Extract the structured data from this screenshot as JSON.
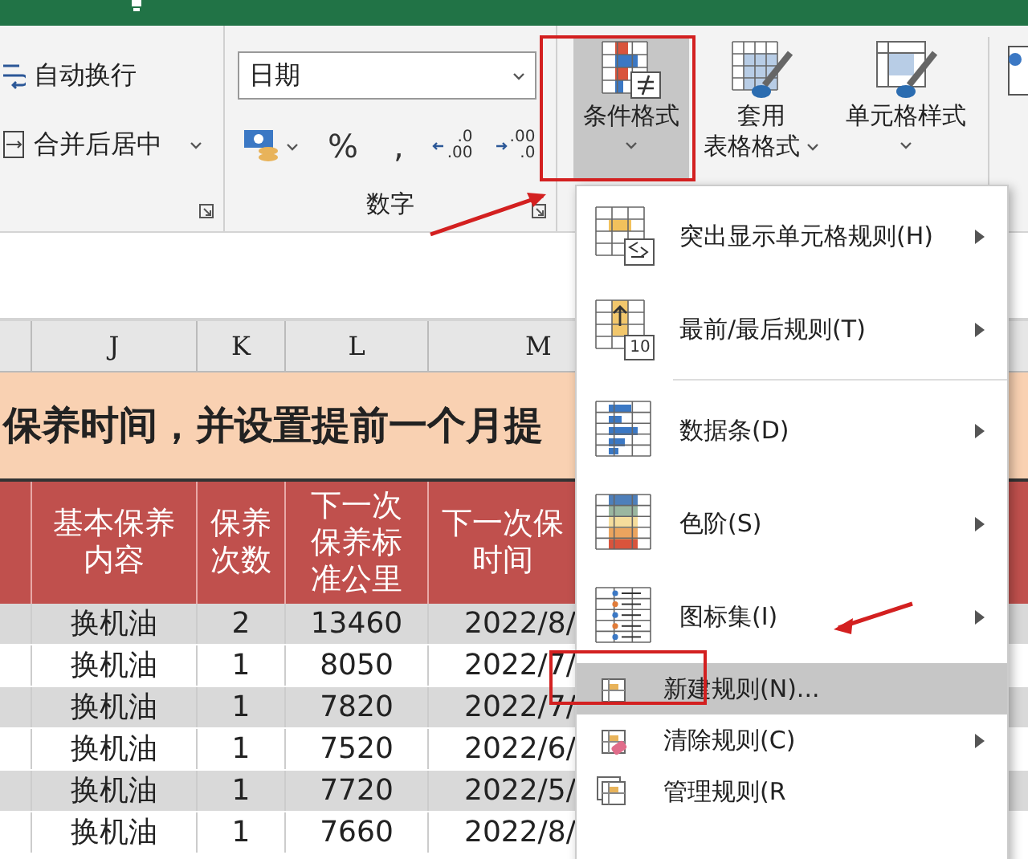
{
  "ribbon": {
    "alignment_group": {
      "items": [
        {
          "kind": "wrap",
          "label": "自动换行",
          "has_dropdown": false
        },
        {
          "kind": "merge",
          "label": "合并后居中",
          "has_dropdown": true
        }
      ]
    },
    "number_group": {
      "format_value": "日期",
      "label": "数字",
      "buttons": [
        {
          "kind": "currency"
        },
        {
          "kind": "text",
          "label": "%"
        },
        {
          "kind": "text",
          "label": ","
        },
        {
          "kind": "increase_decimal",
          "top": ".0",
          "bottom": ".00"
        },
        {
          "kind": "decrease_decimal",
          "top": ".00",
          "bottom": ".0"
        }
      ]
    },
    "style_buttons": [
      {
        "kind": "conditional",
        "lines": [
          "条件格式"
        ],
        "selected": true
      },
      {
        "kind": "table",
        "lines": [
          "套用",
          "表格格式"
        ],
        "selected": false
      },
      {
        "kind": "cell",
        "lines": [
          "单元格样式"
        ],
        "selected": false
      }
    ]
  },
  "sheet": {
    "columns": [
      "J",
      "K",
      "L",
      "M"
    ],
    "title": "保养时间，并设置提前一个月提",
    "headers": [
      "基本保养内容",
      "保养次数",
      "下一次保养标准公里",
      "下一次保时间"
    ],
    "rows": [
      [
        "换机油",
        "2",
        "13460",
        "2022/8/"
      ],
      [
        "换机油",
        "1",
        "8050",
        "2022/7/"
      ],
      [
        "换机油",
        "1",
        "7820",
        "2022/7/"
      ],
      [
        "换机油",
        "1",
        "7520",
        "2022/6/"
      ],
      [
        "换机油",
        "1",
        "7720",
        "2022/5/"
      ],
      [
        "换机油",
        "1",
        "7660",
        "2022/8/"
      ]
    ]
  },
  "menu": {
    "items": [
      {
        "kind": "highlight",
        "label": "突出显示单元格规则(H)",
        "has_submenu": true,
        "selected": false
      },
      {
        "kind": "topbottom",
        "label": "最前/最后规则(T)",
        "badge": "10",
        "has_submenu": true,
        "selected": false
      },
      {
        "kind": "separator"
      },
      {
        "kind": "databar",
        "label": "数据条(D)",
        "has_submenu": true,
        "selected": false
      },
      {
        "kind": "colorscale",
        "label": "色阶(S)",
        "has_submenu": true,
        "selected": false
      },
      {
        "kind": "iconset",
        "label": "图标集(I)",
        "has_submenu": true,
        "selected": false
      },
      {
        "kind": "new",
        "label": "新建规则(N)...",
        "has_submenu": false,
        "selected": true
      },
      {
        "kind": "clear",
        "label": "清除规则(C)",
        "has_submenu": true,
        "selected": false
      },
      {
        "kind": "manage",
        "label": "管理规则(R",
        "has_submenu": false,
        "selected": false
      }
    ]
  }
}
